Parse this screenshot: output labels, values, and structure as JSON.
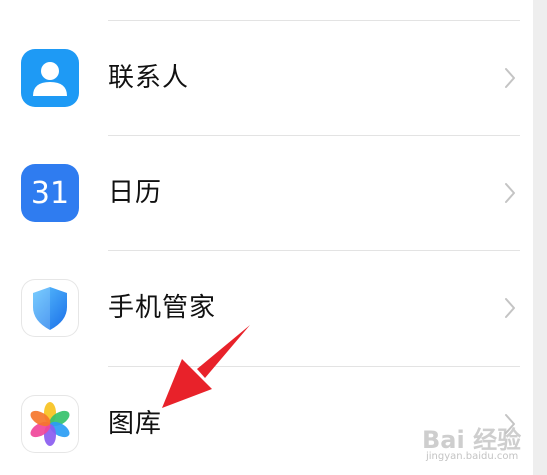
{
  "settings_list": {
    "items": [
      {
        "label": "联系人",
        "icon": "contacts-icon"
      },
      {
        "label": "日历",
        "icon": "calendar-icon",
        "icon_text": "31"
      },
      {
        "label": "手机管家",
        "icon": "phone-manager-shield-icon"
      },
      {
        "label": "图库",
        "icon": "gallery-pinwheel-icon"
      }
    ]
  },
  "watermark": {
    "main": "Bai 经验",
    "sub": "jingyan.baidu.com"
  },
  "colors": {
    "contacts_blue": "#1e9af5",
    "calendar_blue": "#2f7cf0",
    "shield_blue": "#1a8df0",
    "arrow_red": "#e8222a"
  }
}
